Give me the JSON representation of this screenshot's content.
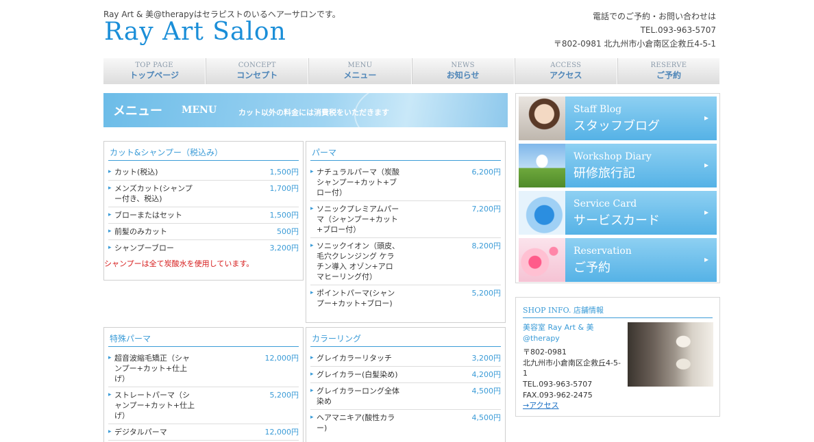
{
  "header": {
    "tagline": "Ray Art & 美@therapyはセラピストのいるヘアーサロンです。",
    "logo": "Ray Art Salon",
    "contact_line1": "電話でのご予約・お問い合わせは",
    "contact_line2": "TEL.093-963-5707",
    "contact_line3": "〒802-0981 北九州市小倉南区企救丘4-5-1"
  },
  "nav": [
    {
      "en": "TOP PAGE",
      "jp": "トップページ"
    },
    {
      "en": "CONCEPT",
      "jp": "コンセプト"
    },
    {
      "en": "MENU",
      "jp": "メニュー"
    },
    {
      "en": "NEWS",
      "jp": "お知らせ"
    },
    {
      "en": "ACCESS",
      "jp": "アクセス"
    },
    {
      "en": "RESERVE",
      "jp": "ご予約"
    }
  ],
  "banner": {
    "jp": "メニュー",
    "en": "MENU",
    "note": "カット以外の料金には消費税をいただきます"
  },
  "menu": {
    "cut": {
      "title": "カット&シャンプー（税込み）",
      "items": [
        {
          "name": "カット(税込)",
          "price": "1,500円"
        },
        {
          "name": "メンズカット(シャンプー付き、税込)",
          "price": "1,700円"
        },
        {
          "name": "ブローまたはセット",
          "price": "1,500円"
        },
        {
          "name": "前髪のみカット",
          "price": "500円"
        },
        {
          "name": "シャンプーブロー",
          "price": "3,200円"
        }
      ],
      "note": "シャンプーは全て炭酸水を使用しています。"
    },
    "perm": {
      "title": "パーマ",
      "items": [
        {
          "name": "ナチュラルパーマ（炭酸シャンプー+カット+ブロー付）",
          "price": "6,200円"
        },
        {
          "name": "ソニックプレミアムパーマ（シャンプー+カット+ブロー付）",
          "price": "7,200円"
        },
        {
          "name": "ソニックイオン（頭皮、毛穴クレンジング ケラチン導入 オゾン+アロマヒーリング付）",
          "price": "8,200円"
        },
        {
          "name": "ポイントパーマ(シャンプー+カット+ブロー)",
          "price": "5,200円"
        }
      ]
    },
    "special": {
      "title": "特殊パーマ",
      "items": [
        {
          "name": "超音波縮毛矯正（シャンプー+カット+仕上げ）",
          "price": "12,000円"
        },
        {
          "name": "ストレートパーマ（シャンプー+カット+仕上げ）",
          "price": "5,200円"
        },
        {
          "name": "デジタルパーマ",
          "price": "12,000円"
        }
      ]
    },
    "color": {
      "title": "カラーリング",
      "items": [
        {
          "name": "グレイカラーリタッチ",
          "price": "3,200円"
        },
        {
          "name": "グレイカラー(白髪染め)",
          "price": "4,200円"
        },
        {
          "name": "グレイカラーロング全体染め",
          "price": "4,500円"
        },
        {
          "name": "ヘアマニキア(酸性カラー)",
          "price": "4,500円"
        }
      ]
    }
  },
  "sidebar": {
    "links": [
      {
        "en": "Staff Blog",
        "jp": "スタッフブログ"
      },
      {
        "en": "Workshop Diary",
        "jp": "研修旅行記"
      },
      {
        "en": "Service Card",
        "jp": "サービスカード"
      },
      {
        "en": "Reservation",
        "jp": "ご予約"
      }
    ],
    "shop": {
      "title": "SHOP INFO.  店舗情報",
      "name": "美容室 Ray Art & 美@therapy",
      "zip": "〒802-0981",
      "address": "北九州市小倉南区企救丘4-5-1",
      "tel": "TEL.093-963-5707",
      "fax": "FAX.093-962-2475",
      "access_link": "→アクセス"
    }
  }
}
